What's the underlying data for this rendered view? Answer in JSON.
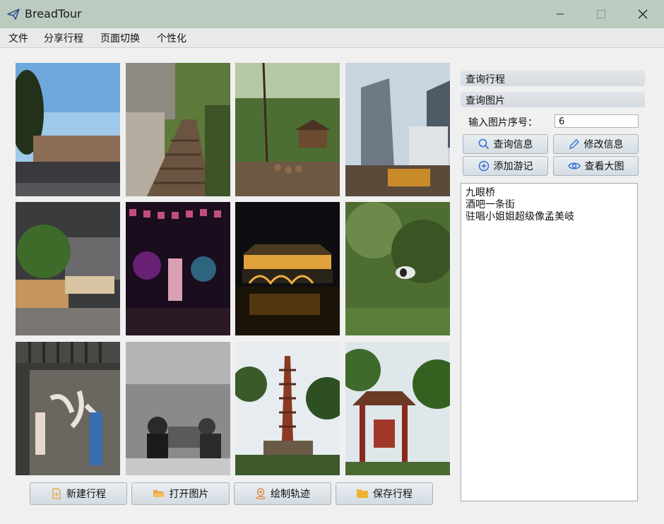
{
  "window": {
    "title": "BreadTour"
  },
  "menu": [
    "文件",
    "分享行程",
    "页面切换",
    "个性化"
  ],
  "bottom_buttons": {
    "new_trip": "新建行程",
    "open_image": "打开图片",
    "draw_track": "绘制轨迹",
    "save_trip": "保存行程"
  },
  "panel": {
    "query_trip": "查询行程",
    "query_image": "查询图片",
    "index_label": "输入图片序号：",
    "index_value": "6",
    "query_info": "查询信息",
    "edit_info": "修改信息",
    "add_note": "添加游记",
    "view_large": "查看大图",
    "notes": [
      "九眼桥",
      "酒吧一条街",
      "驻唱小姐姐超级像孟美岐"
    ]
  },
  "colors": {
    "titlebar": "#bccbc0",
    "icon_blue": "#2f6fd6",
    "icon_orange": "#e8a33c"
  },
  "icons": [
    "paper-plane-icon",
    "minimize-icon",
    "maximize-icon",
    "close-icon",
    "search-icon",
    "pencil-icon",
    "plus-circle-icon",
    "eye-icon",
    "file-plus-icon",
    "folder-open-icon",
    "location-pin-icon",
    "folder-icon"
  ]
}
